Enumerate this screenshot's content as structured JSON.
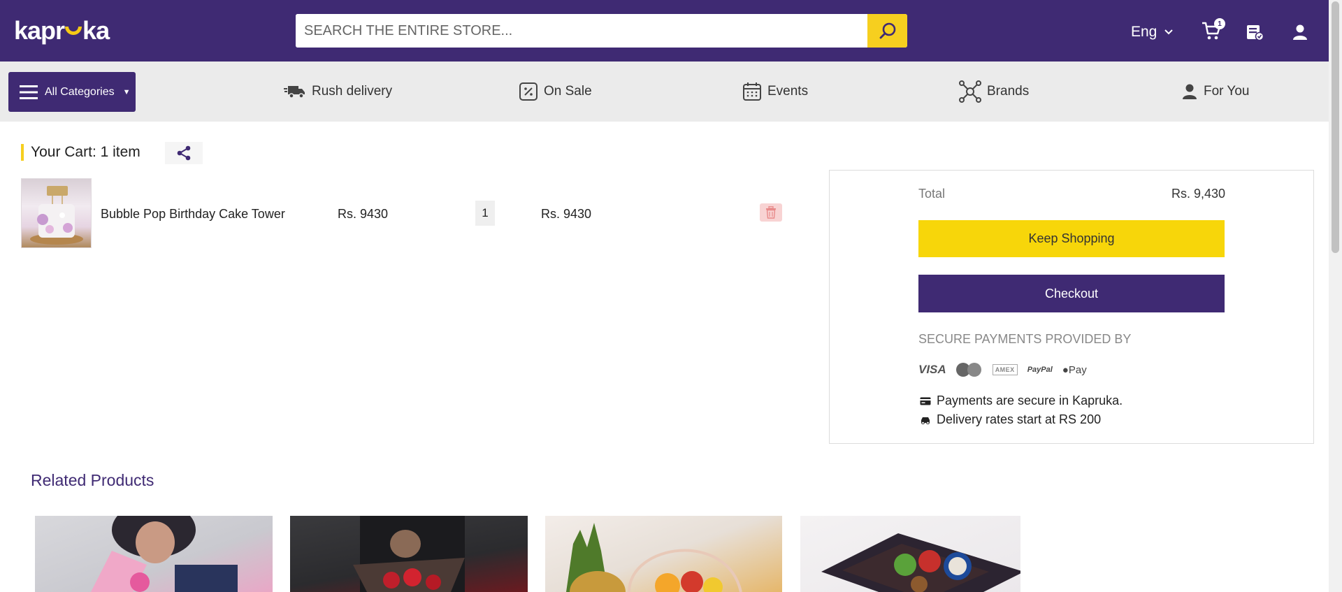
{
  "brand": {
    "logo_text_a": "kapr",
    "logo_text_b": "ka",
    "accent": "#3f2a73",
    "highlight": "#f6cf1f"
  },
  "header": {
    "search_placeholder": "SEARCH THE ENTIRE STORE...",
    "language": "Eng",
    "cart_count": "1",
    "icons": [
      "search-icon",
      "chevron-down-icon",
      "cart-icon",
      "orders-icon",
      "user-icon"
    ]
  },
  "nav": {
    "all_categories": "All Categories",
    "items": [
      {
        "label": "Rush delivery",
        "icon": "truck-icon"
      },
      {
        "label": "On Sale",
        "icon": "percent-tag-icon"
      },
      {
        "label": "Events",
        "icon": "calendar-icon"
      },
      {
        "label": "Brands",
        "icon": "network-icon"
      },
      {
        "label": "For You",
        "icon": "person-icon"
      }
    ]
  },
  "cart": {
    "title": "Your Cart: 1 item",
    "items": [
      {
        "name": "Bubble Pop Birthday Cake Tower",
        "price": "Rs. 9430",
        "qty": "1",
        "total": "Rs. 9430"
      }
    ]
  },
  "summary": {
    "total_label": "Total",
    "total_value": "Rs. 9,430",
    "keep_shopping": "Keep Shopping",
    "checkout": "Checkout",
    "secure_title": "SECURE PAYMENTS PROVIDED BY",
    "payment_methods": [
      "VISA",
      "MasterCard",
      "AMERICAN EXPRESS",
      "PayPal",
      "Pay"
    ],
    "secure_note": "Payments are secure in Kapruka.",
    "delivery_note": "Delivery rates start at RS 200"
  },
  "related": {
    "title": "Related Products"
  }
}
